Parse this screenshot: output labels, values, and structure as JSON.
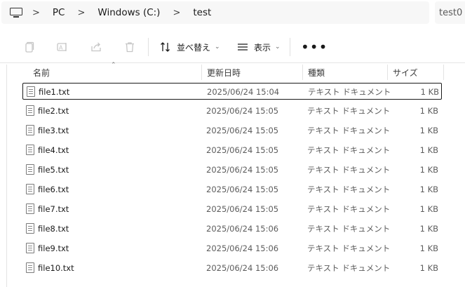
{
  "address": {
    "crumbs": [
      "PC",
      "Windows (C:)",
      "test"
    ],
    "search_text": "test0"
  },
  "toolbar": {
    "sort_label": "並べ替え",
    "view_label": "表示",
    "more_label": "•••"
  },
  "columns": {
    "name": "名前",
    "date": "更新日時",
    "type": "種類",
    "size": "サイズ"
  },
  "files": [
    {
      "name": "file1.txt",
      "date": "2025/06/24 15:04",
      "type": "テキスト ドキュメント",
      "size": "1 KB"
    },
    {
      "name": "file2.txt",
      "date": "2025/06/24 15:05",
      "type": "テキスト ドキュメント",
      "size": "1 KB"
    },
    {
      "name": "file3.txt",
      "date": "2025/06/24 15:05",
      "type": "テキスト ドキュメント",
      "size": "1 KB"
    },
    {
      "name": "file4.txt",
      "date": "2025/06/24 15:05",
      "type": "テキスト ドキュメント",
      "size": "1 KB"
    },
    {
      "name": "file5.txt",
      "date": "2025/06/24 15:05",
      "type": "テキスト ドキュメント",
      "size": "1 KB"
    },
    {
      "name": "file6.txt",
      "date": "2025/06/24 15:05",
      "type": "テキスト ドキュメント",
      "size": "1 KB"
    },
    {
      "name": "file7.txt",
      "date": "2025/06/24 15:05",
      "type": "テキスト ドキュメント",
      "size": "1 KB"
    },
    {
      "name": "file8.txt",
      "date": "2025/06/24 15:06",
      "type": "テキスト ドキュメント",
      "size": "1 KB"
    },
    {
      "name": "file9.txt",
      "date": "2025/06/24 15:06",
      "type": "テキスト ドキュメント",
      "size": "1 KB"
    },
    {
      "name": "file10.txt",
      "date": "2025/06/24 15:06",
      "type": "テキスト ドキュメント",
      "size": "1 KB"
    }
  ],
  "selected_index": 0
}
